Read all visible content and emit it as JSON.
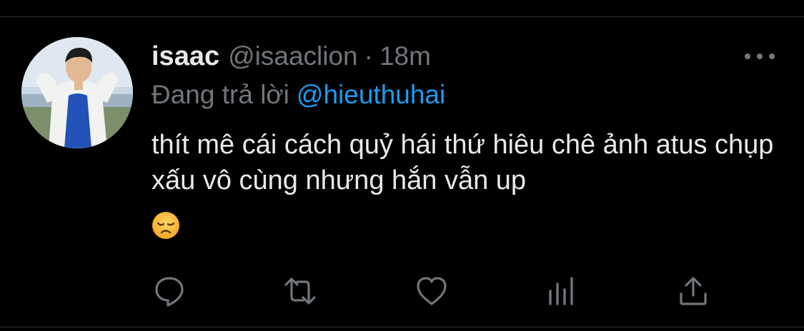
{
  "tweet": {
    "display_name": "isaac",
    "handle": "@isaaclion",
    "separator": "·",
    "time": "18m",
    "reply_prefix": "Đang trả lời",
    "reply_to": "@hieuthuhai",
    "text": "thít mê cái cách quỷ hái thứ hiêu chê ảnh atus chụp xấu vô cùng nhưng hắn vẫn up",
    "emoji": "disappointed-face"
  },
  "icons": {
    "more": "more-horizontal-icon",
    "reply": "reply-icon",
    "retweet": "retweet-icon",
    "like": "heart-icon",
    "views": "analytics-icon",
    "share": "share-icon"
  },
  "colors": {
    "background": "#000000",
    "text_primary": "#e7e9ea",
    "text_secondary": "#71767b",
    "link": "#1d9bf0",
    "divider": "#2f3336"
  }
}
